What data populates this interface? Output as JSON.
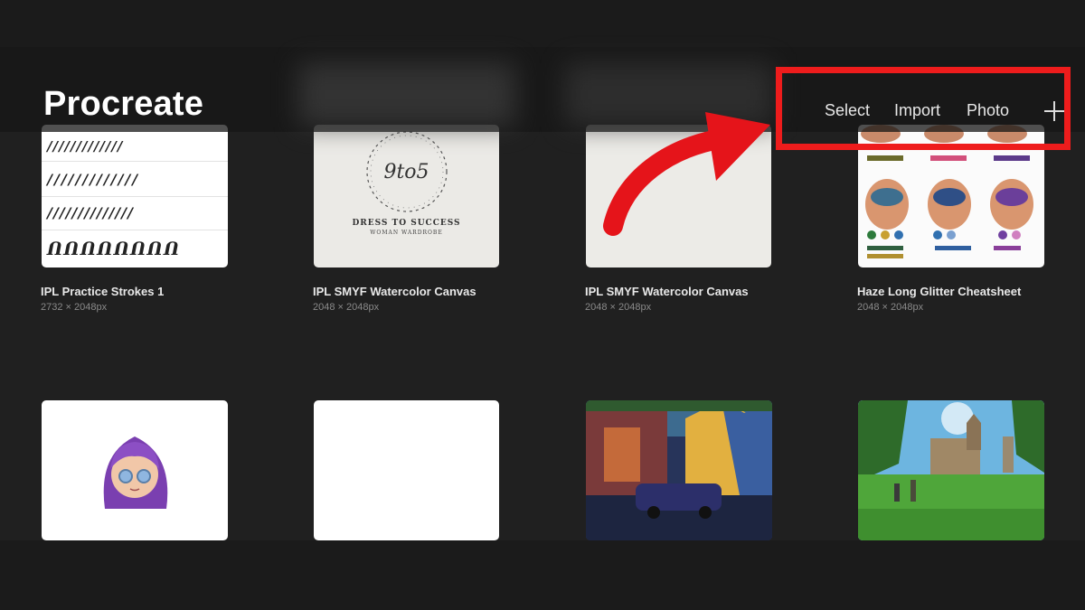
{
  "header": {
    "app_title": "Procreate",
    "actions": {
      "select": "Select",
      "import": "Import",
      "photo": "Photo"
    },
    "plus_icon": "plus-icon"
  },
  "gallery": {
    "items": [
      {
        "title": "IPL Practice Strokes 1",
        "dims": "2732 × 2048px"
      },
      {
        "title": "IPL SMYF Watercolor Canvas",
        "dims": "2048 × 2048px",
        "thumb_text": {
          "logo": "9to5",
          "line1": "DRESS TO SUCCESS",
          "line2": "WOMAN WARDROBE"
        }
      },
      {
        "title": "IPL SMYF Watercolor Canvas",
        "dims": "2048 × 2048px"
      },
      {
        "title": "Haze Long Glitter Cheatsheet",
        "dims": "2048 × 2048px"
      },
      {
        "title": "",
        "dims": ""
      },
      {
        "title": "",
        "dims": ""
      },
      {
        "title": "",
        "dims": ""
      },
      {
        "title": "",
        "dims": ""
      }
    ]
  },
  "annotations": {
    "highlight_color": "#ee1c1c",
    "arrow_color": "#e5141a"
  }
}
